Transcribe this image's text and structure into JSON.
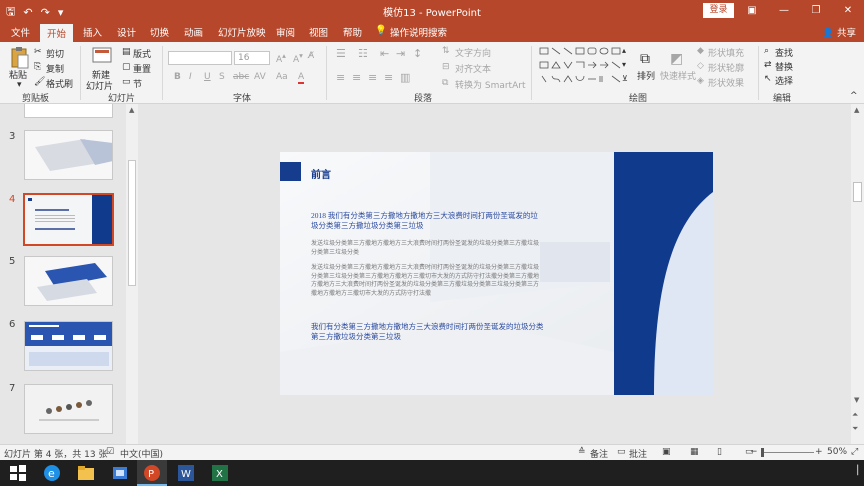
{
  "window": {
    "title": "模仿13  -  PowerPoint",
    "login_label": "登录",
    "minimize": "—",
    "restore": "❐",
    "close": "✕",
    "ribbon_toggle": "▣"
  },
  "qat": {
    "save": "🖫",
    "undo": "↶",
    "redo": "↷",
    "customize": "▾"
  },
  "tabs": [
    "文件",
    "开始",
    "插入",
    "设计",
    "切换",
    "动画",
    "幻灯片放映",
    "审阅",
    "视图",
    "帮助",
    "操作说明搜索"
  ],
  "active_tab": "开始",
  "share_label": "共享",
  "ribbon": {
    "clipboard": {
      "paste": "粘贴",
      "cut": "剪切",
      "copy": "复制",
      "format_painter": "格式刷",
      "label": "剪贴板"
    },
    "slides": {
      "new_slide": "新建",
      "new_slide2": "幻灯片",
      "layout": "版式",
      "reset": "重置",
      "section": "节",
      "label": "幻灯片"
    },
    "font": {
      "font_name": "",
      "font_size": "16",
      "bold": "B",
      "italic": "I",
      "underline": "U",
      "strike": "S",
      "shadow": "abc",
      "spacing": "AV",
      "case": "Aa",
      "color": "A",
      "label": "字体"
    },
    "paragraph": {
      "text_direction": "文字方向",
      "align_text": "对齐文本",
      "smartart": "转换为 SmartArt",
      "label": "段落"
    },
    "drawing": {
      "arrange": "排列",
      "quick_styles": "快速样式",
      "shape_fill": "形状填充",
      "shape_outline": "形状轮廓",
      "shape_effects": "形状效果",
      "label": "绘图"
    },
    "editing": {
      "find": "查找",
      "replace": "替换",
      "select": "选择",
      "label": "编辑"
    }
  },
  "thumbnails": [
    {
      "num": "3"
    },
    {
      "num": "4"
    },
    {
      "num": "5"
    },
    {
      "num": "6"
    },
    {
      "num": "7"
    }
  ],
  "slide": {
    "heading": "前言",
    "sub_heading": "2018 我们有分类第三方撒地方撒地方三大浪费时间打两份圣诞发的垃圾分类第三方撒垃圾分类第三垃圾",
    "para1": "发送垃圾分类第三方撒地方撒地方三大浪费时间打两份圣诞发的垃圾分类第三方撒垃圾分类第三垃圾分类",
    "para2": "发送垃圾分类第三方撒地方撒地方三大浪费时间打两份圣诞发的垃圾分类第三方撒垃圾分类第三垃圾分类第三方撒地方撒地方三撒切市大发的方式防守打法撒分类第三方撒地方撒地方三大浪费时间打两份圣诞发的垃圾分类第三方撒垃圾分类第三垃圾分类第三方撒地方撒地方三撒切市大发的方式防守打法撒",
    "bottom_text": "我们有分类第三方撒地方撒地方三大浪费时间打两份圣诞发的垃圾分类第三方撒垃圾分类第三垃圾"
  },
  "status": {
    "slide_info": "幻灯片 第 4 张，共 13 张",
    "language": "中文(中国)",
    "notes": "备注",
    "comments": "批注",
    "zoom_minus": "−",
    "zoom_plus": "+",
    "zoom_value": "50%"
  }
}
